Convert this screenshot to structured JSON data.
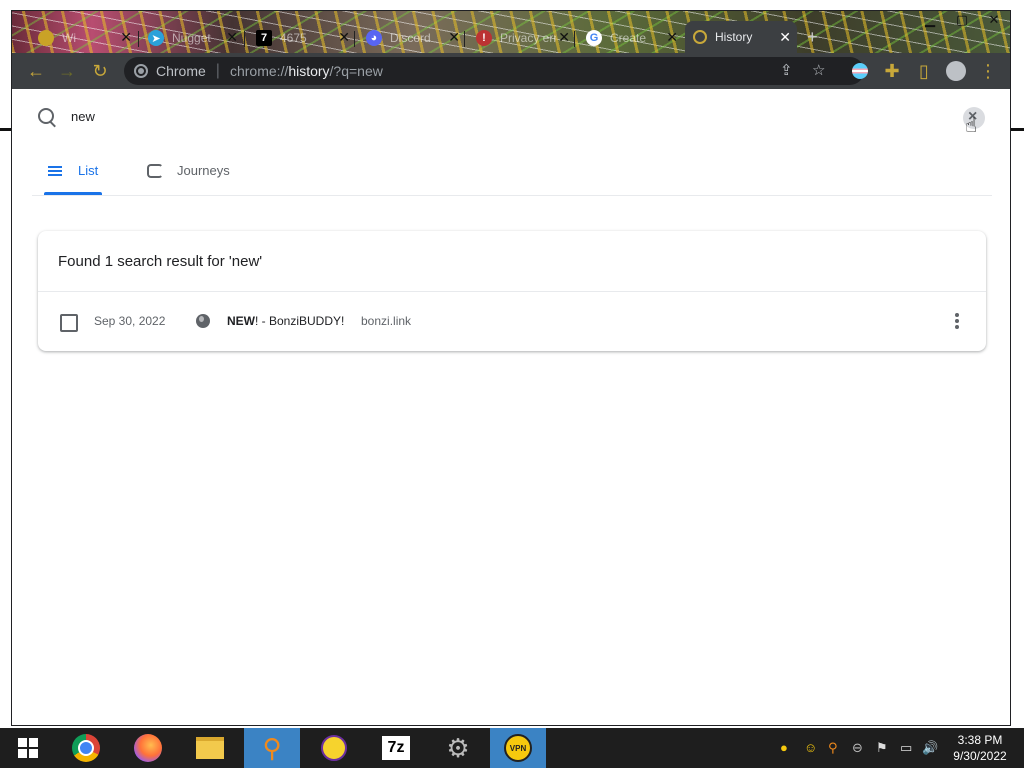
{
  "browser": {
    "tabs": [
      {
        "title": "Wi",
        "favicon": "yellow-circle-icon"
      },
      {
        "title": "Nugget",
        "favicon": "telegram-icon"
      },
      {
        "title": "4675",
        "favicon": "seven-icon"
      },
      {
        "title": "Discord",
        "favicon": "discord-icon"
      },
      {
        "title": "Privacy error",
        "favicon": "warning-icon"
      },
      {
        "title": "Create",
        "favicon": "google-icon"
      },
      {
        "title": "History",
        "favicon": "history-icon",
        "active": true
      }
    ],
    "omnibox": {
      "site_label": "Chrome",
      "url_prefix": "chrome://",
      "url_host": "history",
      "url_suffix": "/?q=new"
    }
  },
  "history": {
    "search_value": "new",
    "tabs": [
      {
        "label": "List",
        "active": true
      },
      {
        "label": "Journeys",
        "active": false
      }
    ],
    "results_header": "Found 1 search result for 'new'",
    "entries": [
      {
        "date": "Sep 30, 2022",
        "title_bold": "NEW",
        "title_rest": "! - BonziBUDDY!",
        "domain": "bonzi.link"
      }
    ]
  },
  "taskbar": {
    "clock_time": "3:38 PM",
    "clock_date": "9/30/2022"
  },
  "colors": {
    "accent": "#1a73e8",
    "toolbar": "#3c3f42",
    "taskbar": "#1e1e1e",
    "taskbar_selected": "#3b83c4"
  }
}
